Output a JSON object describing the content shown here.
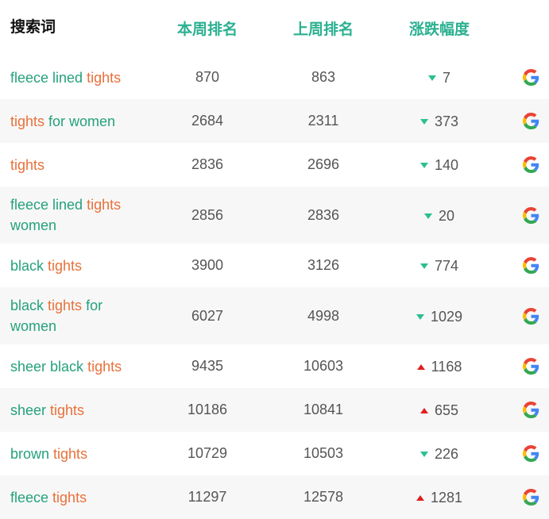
{
  "header": {
    "term": "搜索词",
    "this_week": "本周排名",
    "last_week": "上周排名",
    "change": "涨跌幅度"
  },
  "colors": {
    "keyword": "#e8703a",
    "other": "#25a17c",
    "down": "#2bbf92",
    "up": "#e02020",
    "header_accent": "#2ab090"
  },
  "rows": [
    {
      "parts": [
        {
          "t": "fleece lined ",
          "k": false
        },
        {
          "t": "tights",
          "k": true
        }
      ],
      "this": "870",
      "last": "863",
      "dir": "down",
      "change": "7",
      "icon": "google-icon"
    },
    {
      "parts": [
        {
          "t": "tights",
          "k": true
        },
        {
          "t": " for women",
          "k": false
        }
      ],
      "this": "2684",
      "last": "2311",
      "dir": "down",
      "change": "373",
      "icon": "google-icon"
    },
    {
      "parts": [
        {
          "t": "tights",
          "k": true
        }
      ],
      "this": "2836",
      "last": "2696",
      "dir": "down",
      "change": "140",
      "icon": "google-icon"
    },
    {
      "parts": [
        {
          "t": "fleece lined ",
          "k": false
        },
        {
          "t": "tights",
          "k": true
        },
        {
          "t": " women",
          "k": false
        }
      ],
      "this": "2856",
      "last": "2836",
      "dir": "down",
      "change": "20",
      "icon": "google-icon"
    },
    {
      "parts": [
        {
          "t": "black ",
          "k": false
        },
        {
          "t": "tights",
          "k": true
        }
      ],
      "this": "3900",
      "last": "3126",
      "dir": "down",
      "change": "774",
      "icon": "google-icon"
    },
    {
      "parts": [
        {
          "t": "black ",
          "k": false
        },
        {
          "t": "tights",
          "k": true
        },
        {
          "t": " for women",
          "k": false
        }
      ],
      "this": "6027",
      "last": "4998",
      "dir": "down",
      "change": "1029",
      "icon": "google-icon"
    },
    {
      "parts": [
        {
          "t": "sheer black ",
          "k": false
        },
        {
          "t": "tights",
          "k": true
        }
      ],
      "this": "9435",
      "last": "10603",
      "dir": "up",
      "change": "1168",
      "icon": "google-icon"
    },
    {
      "parts": [
        {
          "t": "sheer ",
          "k": false
        },
        {
          "t": "tights",
          "k": true
        }
      ],
      "this": "10186",
      "last": "10841",
      "dir": "up",
      "change": "655",
      "icon": "google-icon"
    },
    {
      "parts": [
        {
          "t": "brown ",
          "k": false
        },
        {
          "t": "tights",
          "k": true
        }
      ],
      "this": "10729",
      "last": "10503",
      "dir": "down",
      "change": "226",
      "icon": "google-icon"
    },
    {
      "parts": [
        {
          "t": "fleece ",
          "k": false
        },
        {
          "t": "tights",
          "k": true
        }
      ],
      "this": "11297",
      "last": "12578",
      "dir": "up",
      "change": "1281",
      "icon": "google-icon"
    }
  ]
}
